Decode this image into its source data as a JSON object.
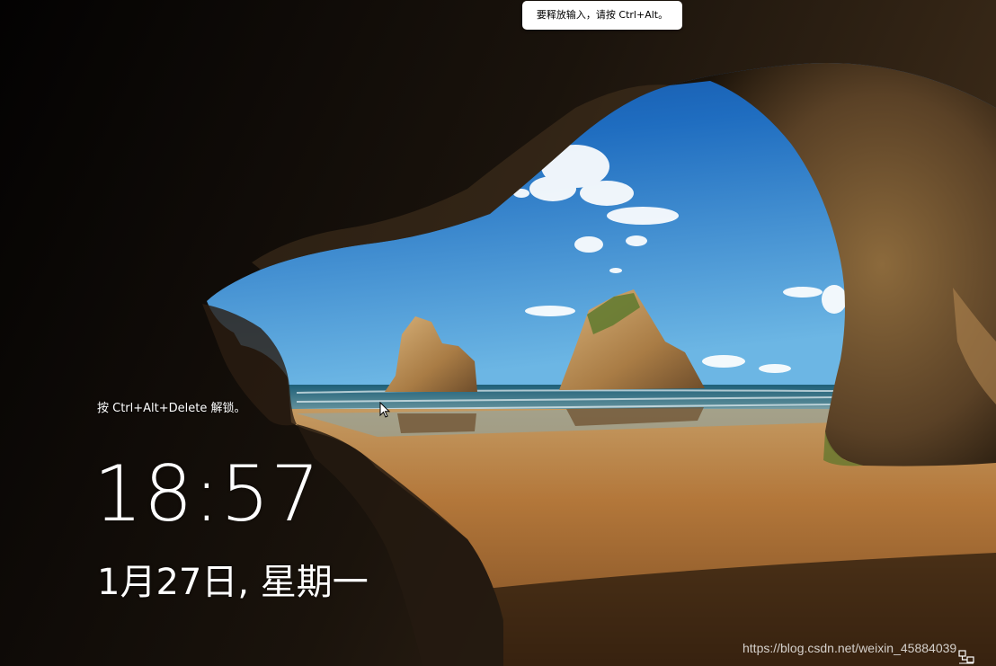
{
  "remote_session": {
    "release_tip": "要释放输入，请按 Ctrl+Alt。"
  },
  "lock_screen": {
    "unlock_hint": "按 Ctrl+Alt+Delete 解锁。",
    "time": "18:57",
    "date": "1月27日, 星期一",
    "background": "cave-beach-wallpaper"
  },
  "watermark": {
    "text": "https://blog.csdn.net/weixin_45884039"
  },
  "status_icons": {
    "network": "network-icon",
    "cursor": "mouse-cursor-icon"
  },
  "colors": {
    "text": "#ffffff",
    "tip_background": "#ffffff",
    "sky_top": "#0b4fa8",
    "sand": "#b9813f"
  }
}
